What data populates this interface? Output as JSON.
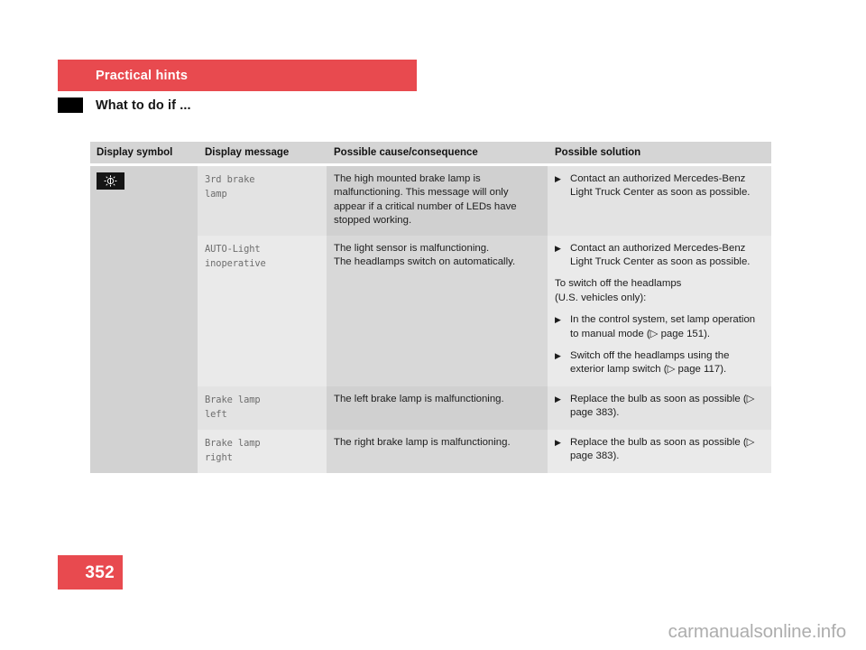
{
  "header": {
    "chapter": "Practical hints",
    "section": "What to do if ..."
  },
  "table": {
    "columns": [
      "Display symbol",
      "Display message",
      "Possible cause/consequence",
      "Possible solution"
    ],
    "rows": [
      {
        "symbol_icon": "lamp-symbol-icon",
        "message": "3rd brake\nlamp",
        "cause": "The high mounted brake lamp is malfunctioning. This message will only appear if a critical number of LEDs have stopped working.",
        "solution_items": [
          "Contact an authorized Mercedes-Benz Light Truck Center as soon as possible."
        ],
        "solution_notes": []
      },
      {
        "symbol_icon": "",
        "message": "AUTO-Light\ninoperative",
        "cause": "The light sensor is malfunctioning.\nThe headlamps switch on automatically.",
        "solution_items": [
          "Contact an authorized Mercedes-Benz Light Truck Center as soon as possible."
        ],
        "solution_note": "To switch off the headlamps\n(U.S. vehicles only):",
        "solution_items_2": [
          "In the control system, set lamp operation to manual mode (▷ page 151).",
          "Switch off the headlamps using the exterior lamp switch (▷ page 117)."
        ]
      },
      {
        "symbol_icon": "",
        "message": "Brake lamp\nleft",
        "cause": "The left brake lamp is malfunctioning.",
        "solution_items": [
          "Replace the bulb as soon as possible (▷ page 383)."
        ]
      },
      {
        "symbol_icon": "",
        "message": "Brake lamp\nright",
        "cause": "The right brake lamp is malfunctioning.",
        "solution_items": [
          "Replace the bulb as soon as possible (▷ page 383)."
        ]
      }
    ]
  },
  "footer": {
    "page_number": "352",
    "watermark": "carmanualsonline.info"
  },
  "colors": {
    "accent_red": "#e84a4f",
    "header_gray": "#d5d5d5",
    "symbol_gray": "#d2d2d2"
  }
}
